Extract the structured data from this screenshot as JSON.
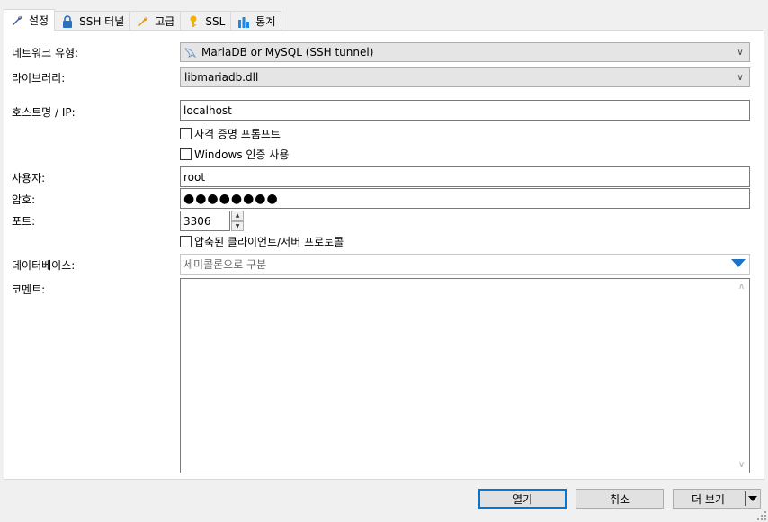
{
  "tabs": [
    {
      "label": "설정",
      "icon": "wrench-icon"
    },
    {
      "label": "SSH 터널",
      "icon": "lock-icon"
    },
    {
      "label": "고급",
      "icon": "wrench-icon"
    },
    {
      "label": "SSL",
      "icon": "key-icon"
    },
    {
      "label": "통계",
      "icon": "bar-chart-icon"
    }
  ],
  "form": {
    "network_type_label": "네트워크 유형:",
    "network_type_value": "MariaDB or MySQL (SSH tunnel)",
    "library_label": "라이브러리:",
    "library_value": "libmariadb.dll",
    "host_label": "호스트명 / IP:",
    "host_value": "localhost",
    "prompt_credentials": "자격 증명 프롬프트",
    "windows_auth": "Windows 인증 사용",
    "user_label": "사용자:",
    "user_value": "root",
    "password_label": "암호:",
    "password_value": "●●●●●●●●",
    "port_label": "포트:",
    "port_value": "3306",
    "compressed_protocol": "압축된 클라이언트/서버 프로토콜",
    "database_label": "데이터베이스:",
    "database_placeholder": "세미콜론으로 구분",
    "comment_label": "코멘트:"
  },
  "buttons": {
    "open": "열기",
    "cancel": "취소",
    "more": "더 보기"
  },
  "colors": {
    "accent": "#0078d7",
    "dropdown_arrow": "#1e73c8"
  }
}
